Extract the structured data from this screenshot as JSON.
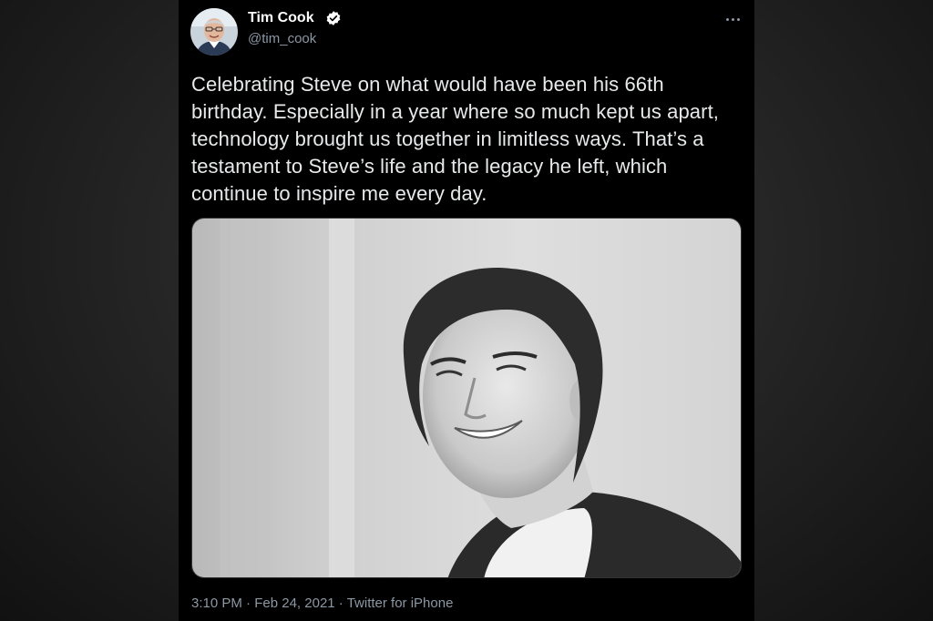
{
  "tweet": {
    "author_name": "Tim Cook",
    "author_handle": "@tim_cook",
    "verified_icon": "verified-badge-icon",
    "more_icon": "more-options-icon",
    "text": "Celebrating Steve on what would have been his 66th birthday. Especially in a year where so much kept us apart, technology brought us together in limitless ways. That’s a testament to Steve’s life and the legacy he left, which continue to inspire me every day.",
    "media_type": "black-and-white portrait photo",
    "time": "3:10 PM",
    "separator": " · ",
    "date": "Feb 24, 2021",
    "source": "Twitter for iPhone"
  },
  "colors": {
    "card_background": "#000000",
    "text_primary": "#e7e9ea",
    "text_secondary": "#8b98a5",
    "verified_blue": "#ffffff"
  }
}
